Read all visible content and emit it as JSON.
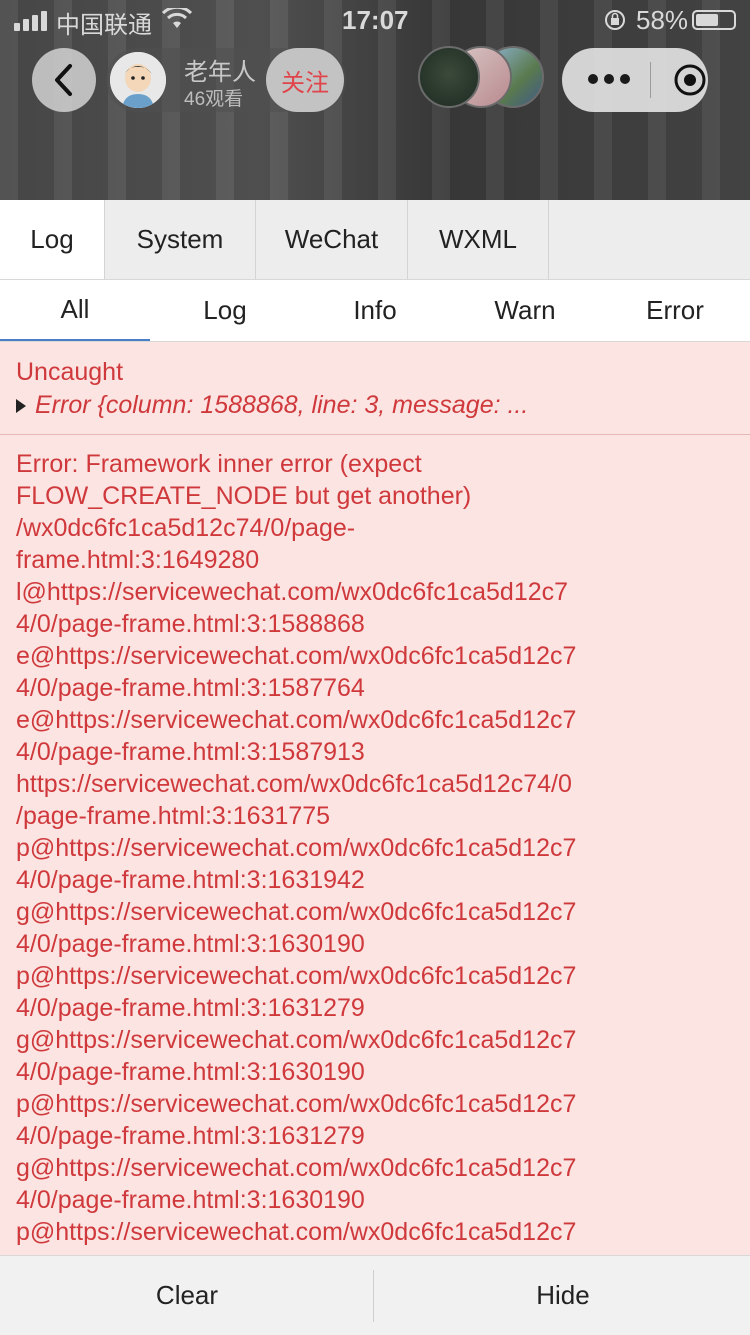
{
  "status_bar": {
    "carrier": "中国联通",
    "time": "17:07",
    "battery": "58%"
  },
  "header": {
    "name": "老年人",
    "viewers": "46观看",
    "follow": "关注"
  },
  "main_tabs": [
    "Log",
    "System",
    "WeChat",
    "WXML"
  ],
  "sub_tabs": [
    "All",
    "Log",
    "Info",
    "Warn",
    "Error"
  ],
  "log": {
    "uncaught": "Uncaught",
    "error_object": "Error {column: 1588868, line: 3, message: ...",
    "lines": [
      "Error: Framework inner error (expect",
      "FLOW_CREATE_NODE but get another)",
      "/wx0dc6fc1ca5d12c74/0/page-",
      "frame.html:3:1649280",
      "l@https://servicewechat.com/wx0dc6fc1ca5d12c7",
      "4/0/page-frame.html:3:1588868",
      "e@https://servicewechat.com/wx0dc6fc1ca5d12c7",
      "4/0/page-frame.html:3:1587764",
      "e@https://servicewechat.com/wx0dc6fc1ca5d12c7",
      "4/0/page-frame.html:3:1587913",
      "https://servicewechat.com/wx0dc6fc1ca5d12c74/0",
      "/page-frame.html:3:1631775",
      "p@https://servicewechat.com/wx0dc6fc1ca5d12c7",
      "4/0/page-frame.html:3:1631942",
      "g@https://servicewechat.com/wx0dc6fc1ca5d12c7",
      "4/0/page-frame.html:3:1630190",
      "p@https://servicewechat.com/wx0dc6fc1ca5d12c7",
      "4/0/page-frame.html:3:1631279",
      "g@https://servicewechat.com/wx0dc6fc1ca5d12c7",
      "4/0/page-frame.html:3:1630190",
      "p@https://servicewechat.com/wx0dc6fc1ca5d12c7",
      "4/0/page-frame.html:3:1631279",
      "g@https://servicewechat.com/wx0dc6fc1ca5d12c7",
      "4/0/page-frame.html:3:1630190",
      "p@https://servicewechat.com/wx0dc6fc1ca5d12c7"
    ]
  },
  "bottom_bar": {
    "clear": "Clear",
    "hide": "Hide"
  },
  "colors": {
    "error_text": "#d0393c",
    "error_bg": "#fbe4e2",
    "active_tab_underline": "#4a7ec7",
    "follow_text": "#e0444a"
  }
}
